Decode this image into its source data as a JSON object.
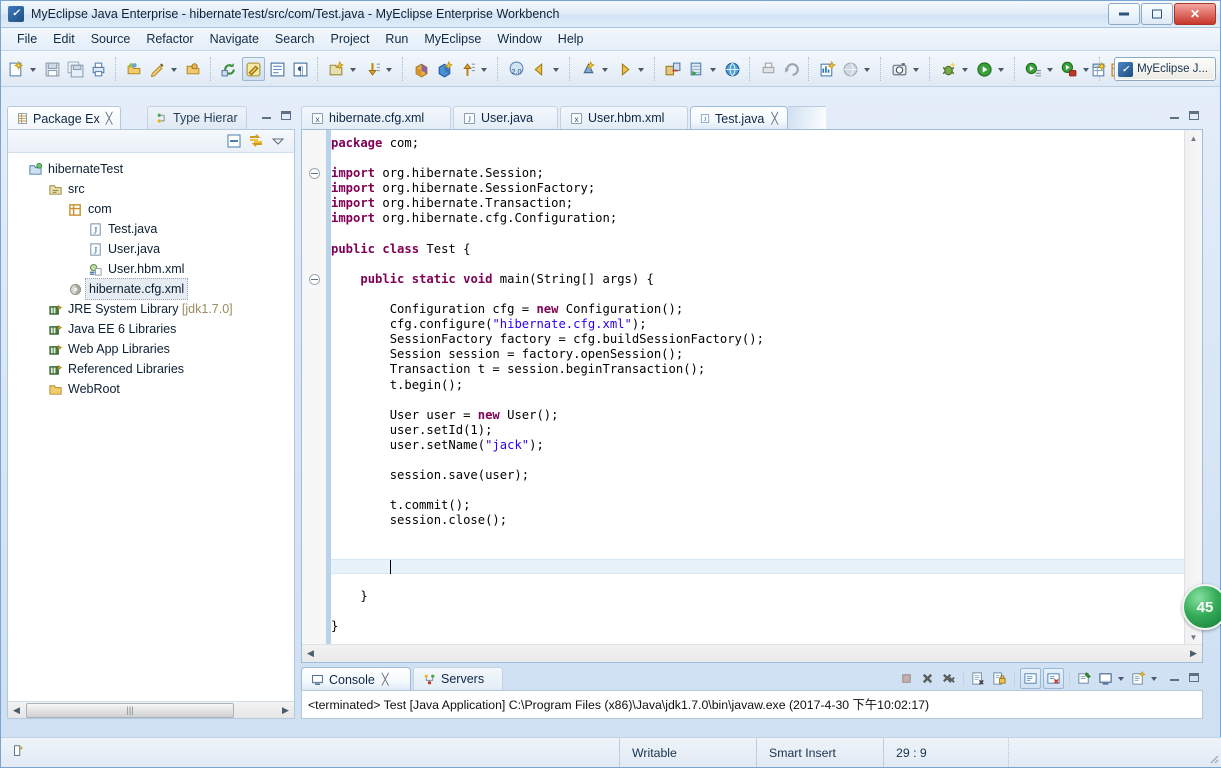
{
  "window": {
    "title": "MyEclipse Java Enterprise - hibernateTest/src/com/Test.java - MyEclipse Enterprise Workbench",
    "app_icon": "myeclipse-icon",
    "minimize_label": "minimize-icon",
    "maximize_label": "maximize-icon",
    "close_label": "✕"
  },
  "menubar": {
    "items": [
      {
        "label": "File"
      },
      {
        "label": "Edit"
      },
      {
        "label": "Source"
      },
      {
        "label": "Refactor"
      },
      {
        "label": "Navigate"
      },
      {
        "label": "Search"
      },
      {
        "label": "Project"
      },
      {
        "label": "Run"
      },
      {
        "label": "MyEclipse"
      },
      {
        "label": "Window"
      },
      {
        "label": "Help"
      }
    ]
  },
  "toolbar": {
    "groups": [
      {
        "buttons": [
          {
            "icon": "new-wizard-icon",
            "dropdown": true
          },
          {
            "icon": "save-icon",
            "dropdown": false
          },
          {
            "icon": "save-all-icon",
            "dropdown": false
          },
          {
            "icon": "print-icon",
            "dropdown": false
          }
        ]
      },
      {
        "buttons": [
          {
            "icon": "open-type-icon",
            "dropdown": false
          },
          {
            "icon": "quick-fix-icon",
            "dropdown": true
          },
          {
            "icon": "open-resource-icon",
            "dropdown": false
          }
        ]
      },
      {
        "buttons": [
          {
            "icon": "refresh-icon",
            "dropdown": false
          },
          {
            "icon": "toggle-mark-occurrences-icon",
            "dropdown": false,
            "pressed": true
          },
          {
            "icon": "show-whitespace-icon",
            "dropdown": false
          },
          {
            "icon": "pilcrow-icon",
            "dropdown": false
          }
        ]
      },
      {
        "buttons": [
          {
            "icon": "new-java-package-icon",
            "dropdown": true
          },
          {
            "icon": "next-annotation-icon",
            "dropdown": true
          }
        ]
      },
      {
        "buttons": [
          {
            "icon": "new-class-icon",
            "dropdown": false
          },
          {
            "icon": "new-interface-icon",
            "dropdown": false
          },
          {
            "icon": "prev-annotation-icon",
            "dropdown": true
          }
        ]
      },
      {
        "buttons": [
          {
            "icon": "web-2-icon",
            "dropdown": false
          },
          {
            "icon": "back-icon",
            "dropdown": true
          }
        ]
      },
      {
        "buttons": [
          {
            "icon": "db-browser-icon",
            "dropdown": true
          },
          {
            "icon": "forward-icon",
            "dropdown": true
          }
        ]
      },
      {
        "buttons": [
          {
            "icon": "deploy-icon",
            "dropdown": false
          },
          {
            "icon": "run-server-icon",
            "dropdown": true
          },
          {
            "icon": "globe-icon",
            "dropdown": false
          }
        ]
      },
      {
        "buttons": [
          {
            "icon": "print-preview-icon",
            "dropdown": false
          },
          {
            "icon": "undo-icon",
            "dropdown": false
          }
        ]
      },
      {
        "buttons": [
          {
            "icon": "new-report-icon",
            "dropdown": false
          },
          {
            "icon": "web-browser-icon",
            "dropdown": true
          }
        ]
      },
      {
        "buttons": [
          {
            "icon": "snapshot-icon",
            "dropdown": true
          }
        ]
      },
      {
        "buttons": [
          {
            "icon": "debug-icon",
            "dropdown": true
          },
          {
            "icon": "run-icon",
            "dropdown": true
          }
        ]
      },
      {
        "buttons": [
          {
            "icon": "run-config-icon",
            "dropdown": true
          },
          {
            "icon": "run-coverage-icon",
            "dropdown": true
          }
        ]
      },
      {
        "buttons": [
          {
            "icon": "new-package-box-icon",
            "dropdown": false
          },
          {
            "icon": "external-tools-icon",
            "dropdown": true
          }
        ]
      }
    ],
    "perspective": {
      "open_perspective_icon": "open-perspective-icon",
      "current_icon": "myeclipse-perspective-icon",
      "current_label": "MyEclipse J..."
    }
  },
  "left_view": {
    "tabs": [
      {
        "label": "Package Ex",
        "icon": "package-explorer-icon",
        "active": true,
        "closable": true
      },
      {
        "label": "Type Hierar",
        "icon": "type-hierarchy-icon",
        "active": false,
        "closable": false
      }
    ],
    "view_toolbar": [
      {
        "icon": "collapse-all-icon"
      },
      {
        "icon": "link-with-editor-icon"
      },
      {
        "icon": "view-menu-icon"
      }
    ],
    "minimize_icon": "minimize-view-icon",
    "maximize_icon": "maximize-view-icon",
    "tree": [
      {
        "label": "hibernateTest",
        "icon": "java-project-icon",
        "indent": 0,
        "selected": false,
        "suffix": ""
      },
      {
        "label": "src",
        "icon": "source-folder-icon",
        "indent": 1,
        "selected": false,
        "suffix": ""
      },
      {
        "label": "com",
        "icon": "package-icon",
        "indent": 2,
        "selected": false,
        "suffix": ""
      },
      {
        "label": "Test.java",
        "icon": "java-file-icon",
        "indent": 3,
        "selected": false,
        "suffix": ""
      },
      {
        "label": "User.java",
        "icon": "java-file-icon",
        "indent": 3,
        "selected": false,
        "suffix": ""
      },
      {
        "label": "User.hbm.xml",
        "icon": "hbm-xml-icon",
        "indent": 3,
        "selected": false,
        "suffix": ""
      },
      {
        "label": "hibernate.cfg.xml",
        "icon": "hibernate-cfg-icon",
        "indent": 2,
        "selected": true,
        "suffix": ""
      },
      {
        "label": "JRE System Library",
        "icon": "library-icon",
        "indent": 1,
        "selected": false,
        "suffix": " [jdk1.7.0]"
      },
      {
        "label": "Java EE 6 Libraries",
        "icon": "library-icon",
        "indent": 1,
        "selected": false,
        "suffix": ""
      },
      {
        "label": "Web App Libraries",
        "icon": "library-icon",
        "indent": 1,
        "selected": false,
        "suffix": ""
      },
      {
        "label": "Referenced Libraries",
        "icon": "library-icon",
        "indent": 1,
        "selected": false,
        "suffix": ""
      },
      {
        "label": "WebRoot",
        "icon": "folder-icon",
        "indent": 1,
        "selected": false,
        "suffix": ""
      }
    ],
    "hscroll": {
      "left_arrow": "◀",
      "right_arrow": "▶",
      "grip": "|||"
    }
  },
  "editor": {
    "tabs": [
      {
        "label": "hibernate.cfg.xml",
        "icon": "xml-file-icon",
        "active": false,
        "closable": false
      },
      {
        "label": "User.java",
        "icon": "java-file-icon",
        "active": false,
        "closable": false
      },
      {
        "label": "User.hbm.xml",
        "icon": "xml-file-icon",
        "active": false,
        "closable": false
      },
      {
        "label": "Test.java",
        "icon": "java-file-icon",
        "active": true,
        "closable": true
      }
    ],
    "close_glyph": "✕",
    "minimize_icon": "minimize-view-icon",
    "maximize_icon": "maximize-view-icon",
    "code_lines": [
      [
        {
          "t": "package",
          "c": "kw"
        },
        {
          "t": " com;",
          "c": ""
        }
      ],
      [],
      [
        {
          "t": "import",
          "c": "kw"
        },
        {
          "t": " org.hibernate.Session;",
          "c": ""
        }
      ],
      [
        {
          "t": "import",
          "c": "kw"
        },
        {
          "t": " org.hibernate.SessionFactory;",
          "c": ""
        }
      ],
      [
        {
          "t": "import",
          "c": "kw"
        },
        {
          "t": " org.hibernate.Transaction;",
          "c": ""
        }
      ],
      [
        {
          "t": "import",
          "c": "kw"
        },
        {
          "t": " org.hibernate.cfg.Configuration;",
          "c": ""
        }
      ],
      [],
      [
        {
          "t": "public",
          "c": "kw"
        },
        {
          "t": " ",
          "c": ""
        },
        {
          "t": "class",
          "c": "kw"
        },
        {
          "t": " Test {",
          "c": ""
        }
      ],
      [],
      [
        {
          "t": "    ",
          "c": ""
        },
        {
          "t": "public",
          "c": "kw"
        },
        {
          "t": " ",
          "c": ""
        },
        {
          "t": "static",
          "c": "kw"
        },
        {
          "t": " ",
          "c": ""
        },
        {
          "t": "void",
          "c": "kw"
        },
        {
          "t": " main(String[] args) {",
          "c": ""
        }
      ],
      [],
      [
        {
          "t": "        Configuration cfg = ",
          "c": ""
        },
        {
          "t": "new",
          "c": "kw"
        },
        {
          "t": " Configuration();",
          "c": ""
        }
      ],
      [
        {
          "t": "        cfg.configure(",
          "c": ""
        },
        {
          "t": "\"hibernate.cfg.xml\"",
          "c": "str"
        },
        {
          "t": ");",
          "c": ""
        }
      ],
      [
        {
          "t": "        SessionFactory factory = cfg.buildSessionFactory();",
          "c": ""
        }
      ],
      [
        {
          "t": "        Session session = factory.openSession();",
          "c": ""
        }
      ],
      [
        {
          "t": "        Transaction t = session.beginTransaction();",
          "c": ""
        }
      ],
      [
        {
          "t": "        t.begin();",
          "c": ""
        }
      ],
      [],
      [
        {
          "t": "        User user = ",
          "c": ""
        },
        {
          "t": "new",
          "c": "kw"
        },
        {
          "t": " User();",
          "c": ""
        }
      ],
      [
        {
          "t": "        user.setId(1);",
          "c": ""
        }
      ],
      [
        {
          "t": "        user.setName(",
          "c": ""
        },
        {
          "t": "\"jack\"",
          "c": "str"
        },
        {
          "t": ");",
          "c": ""
        }
      ],
      [],
      [
        {
          "t": "        session.save(user);",
          "c": ""
        }
      ],
      [],
      [
        {
          "t": "        t.commit();",
          "c": ""
        }
      ],
      [
        {
          "t": "        session.close();",
          "c": ""
        }
      ],
      [],
      [],
      [],
      [],
      [
        {
          "t": "    }",
          "c": ""
        }
      ],
      [],
      [
        {
          "t": "}",
          "c": ""
        }
      ]
    ],
    "current_line_index": 28,
    "fold_markers": [
      2,
      9
    ],
    "scroll_up_glyph": "▲",
    "scroll_down_glyph": "▼",
    "hscroll_left_glyph": "◀",
    "hscroll_right_glyph": "▶"
  },
  "console": {
    "tabs": [
      {
        "label": "Console",
        "icon": "console-icon",
        "active": true,
        "closable": true
      },
      {
        "label": "Servers",
        "icon": "servers-icon",
        "active": false,
        "closable": false
      }
    ],
    "close_glyph": "✕",
    "output": "<terminated> Test [Java Application] C:\\Program Files (x86)\\Java\\jdk1.7.0\\bin\\javaw.exe (2017-4-30 下午10:02:17)",
    "toolbar": [
      {
        "icon": "terminate-icon",
        "disabled": true
      },
      {
        "icon": "remove-launch-icon"
      },
      {
        "icon": "remove-all-terminated-icon"
      },
      {
        "icon": "clear-console-icon"
      },
      {
        "icon": "scroll-lock-icon"
      },
      {
        "icon": "show-console-when-stdout-icon",
        "pressed": true
      },
      {
        "icon": "show-console-when-stderr-icon",
        "pressed": true
      },
      {
        "icon": "pin-console-icon"
      },
      {
        "icon": "display-selected-console-icon",
        "dropdown": true
      },
      {
        "icon": "open-console-icon",
        "dropdown": true
      }
    ],
    "minimize_icon": "minimize-view-icon",
    "maximize_icon": "maximize-view-icon"
  },
  "statusbar": {
    "left_icon": "smart-insert-status-icon",
    "cells": [
      {
        "label": "Writable"
      },
      {
        "label": "Smart Insert"
      },
      {
        "label": "29 : 9"
      }
    ]
  },
  "badge": {
    "label": "45",
    "color": "#2ba14f"
  },
  "colors": {
    "keyword": "#7f0055",
    "string": "#2a00ff",
    "current_line": "#e8f2fb",
    "selection": "#e6ecf2",
    "accent": "#3d7bbd"
  }
}
